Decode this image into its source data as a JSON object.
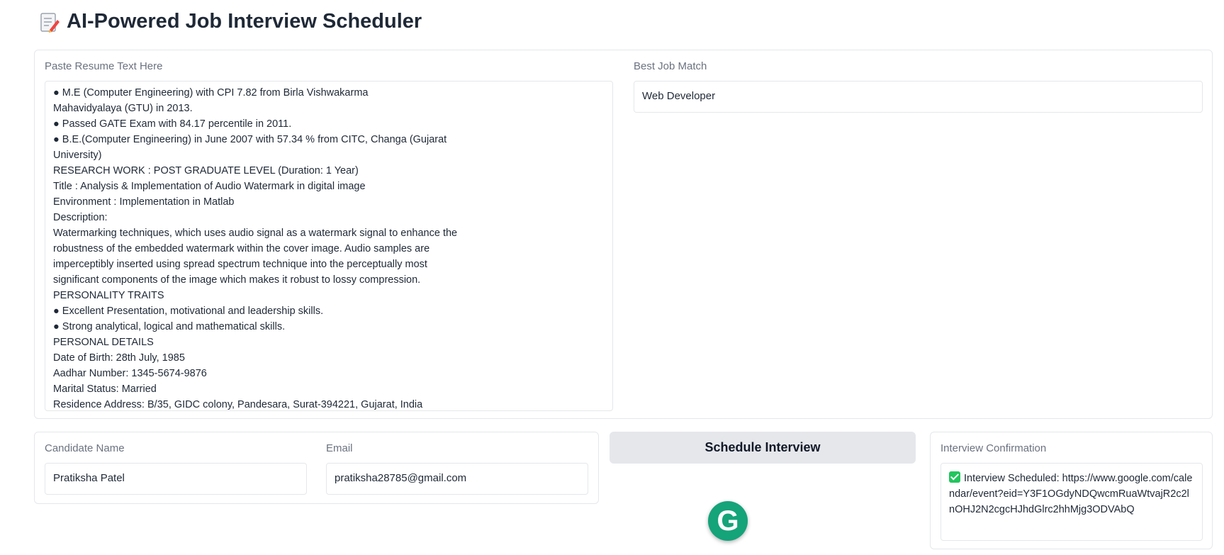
{
  "header": {
    "title": "AI-Powered Job Interview Scheduler",
    "icon": "memo-icon"
  },
  "resume": {
    "label": "Paste Resume Text Here",
    "text": "● M.E (Computer Engineering) with CPI 7.82 from Birla Vishwakarma\nMahavidyalaya (GTU) in 2013.\n● Passed GATE Exam with 84.17 percentile in 2011.\n● B.E.(Computer Engineering) in June 2007 with 57.34 % from CITC, Changa (Gujarat\nUniversity)\nRESEARCH WORK : POST GRADUATE LEVEL (Duration: 1 Year)\nTitle : Analysis & Implementation of Audio Watermark in digital image\nEnvironment : Implementation in Matlab\nDescription:\nWatermarking techniques, which uses audio signal as a watermark signal to enhance the\nrobustness of the embedded watermark within the cover image. Audio samples are\nimperceptibly inserted using spread spectrum technique into the perceptually most\nsignificant components of the image which makes it robust to lossy compression.\nPERSONALITY TRAITS\n● Excellent Presentation, motivational and leadership skills.\n● Strong analytical, logical and mathematical skills.\nPERSONAL DETAILS\nDate of Birth: 28th July, 1985\nAadhar Number: 1345-5674-9876\nMarital Status: Married\nResidence Address: B/35, GIDC colony, Pandesara, Surat-394221, Gujarat, India"
  },
  "job_match": {
    "label": "Best Job Match",
    "value": "Web Developer"
  },
  "candidate": {
    "name_label": "Candidate Name",
    "name_value": "Pratiksha Patel",
    "email_label": "Email",
    "email_value": "pratiksha28785@gmail.com"
  },
  "schedule_button": {
    "label": "Schedule Interview"
  },
  "confirmation": {
    "label": "Interview Confirmation",
    "text": "Interview Scheduled: https://www.google.com/calendar/event?eid=Y3F1OGdyNDQwcmRuaWtvajR2c2lnOHJ2N2cgcHJhdGlrc2hhMjg3ODVAbQ"
  },
  "grammarly": {
    "letter": "G",
    "icon": "grammarly-icon",
    "color": "#15a37a"
  }
}
